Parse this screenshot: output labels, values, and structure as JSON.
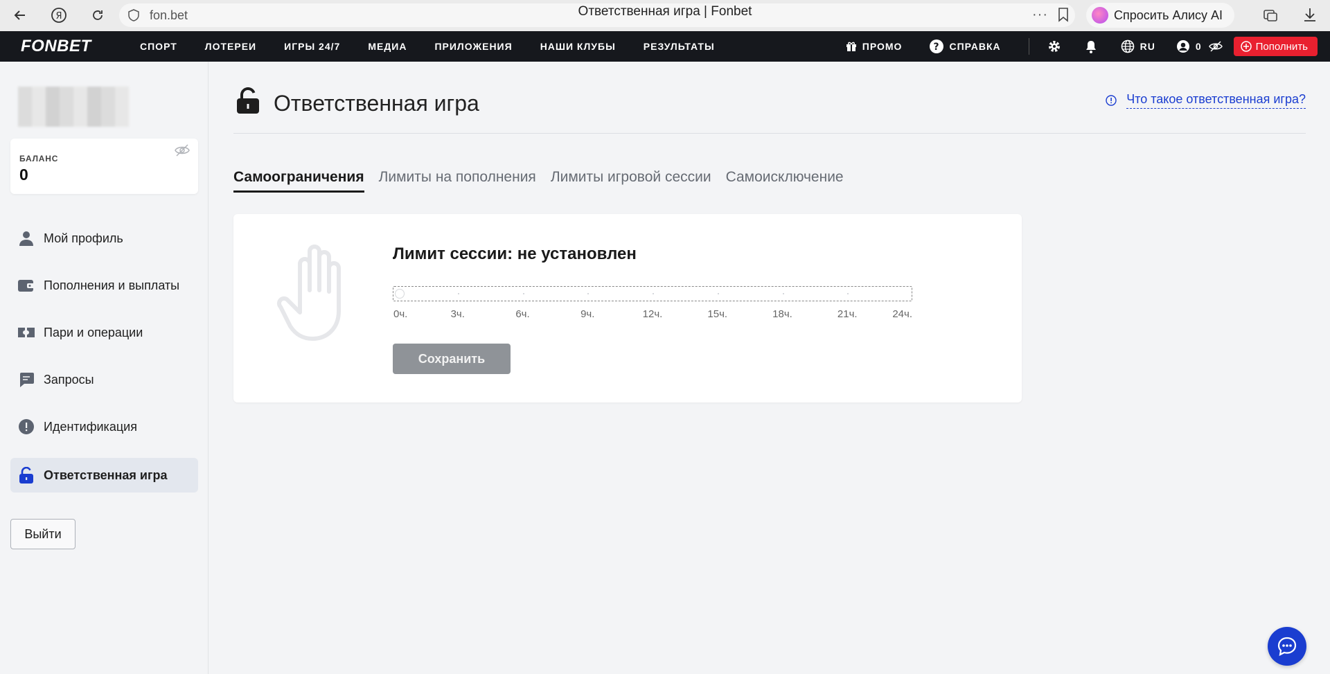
{
  "browser": {
    "url": "fon.bet",
    "tab_title": "Ответственная игра | Fonbet",
    "alice_label": "Спросить Алису AI"
  },
  "header": {
    "logo": "FONBET",
    "nav": [
      "СПОРТ",
      "ЛОТЕРЕИ",
      "ИГРЫ 24/7",
      "МЕДИА",
      "ПРИЛОЖЕНИЯ",
      "НАШИ КЛУБЫ",
      "РЕЗУЛЬТАТЫ"
    ],
    "promo": "ПРОМО",
    "help": "СПРАВКА",
    "lang": "RU",
    "account_balance": "0",
    "deposit": "Пополнить"
  },
  "sidebar": {
    "balance_label": "БАЛАНС",
    "balance_value": "0",
    "items": [
      {
        "label": "Мой профиль",
        "icon": "user-icon"
      },
      {
        "label": "Пополнения и выплаты",
        "icon": "wallet-icon"
      },
      {
        "label": "Пари и операции",
        "icon": "ticket-icon"
      },
      {
        "label": "Запросы",
        "icon": "message-icon"
      },
      {
        "label": "Идентификация",
        "icon": "alert-icon"
      },
      {
        "label": "Ответственная игра",
        "icon": "lock-icon",
        "active": true
      }
    ],
    "logout": "Выйти"
  },
  "main": {
    "title": "Ответственная игра",
    "help_link": "Что такое ответственная игра?",
    "tabs": [
      {
        "label": "Самоограничения",
        "active": true
      },
      {
        "label": "Лимиты на пополнения"
      },
      {
        "label": "Лимиты игровой сессии"
      },
      {
        "label": "Самоисключение"
      }
    ],
    "card": {
      "title": "Лимит сессии: не установлен",
      "slider_value": 0,
      "tick_labels": [
        "0ч.",
        "3ч.",
        "6ч.",
        "9ч.",
        "12ч.",
        "15ч.",
        "18ч.",
        "21ч.",
        "24ч."
      ],
      "save": "Сохранить"
    }
  },
  "colors": {
    "accent": "#1a3dd0",
    "header_bg": "#16181d",
    "deposit_red": "#e9202f",
    "disabled_button": "#8f9398"
  }
}
